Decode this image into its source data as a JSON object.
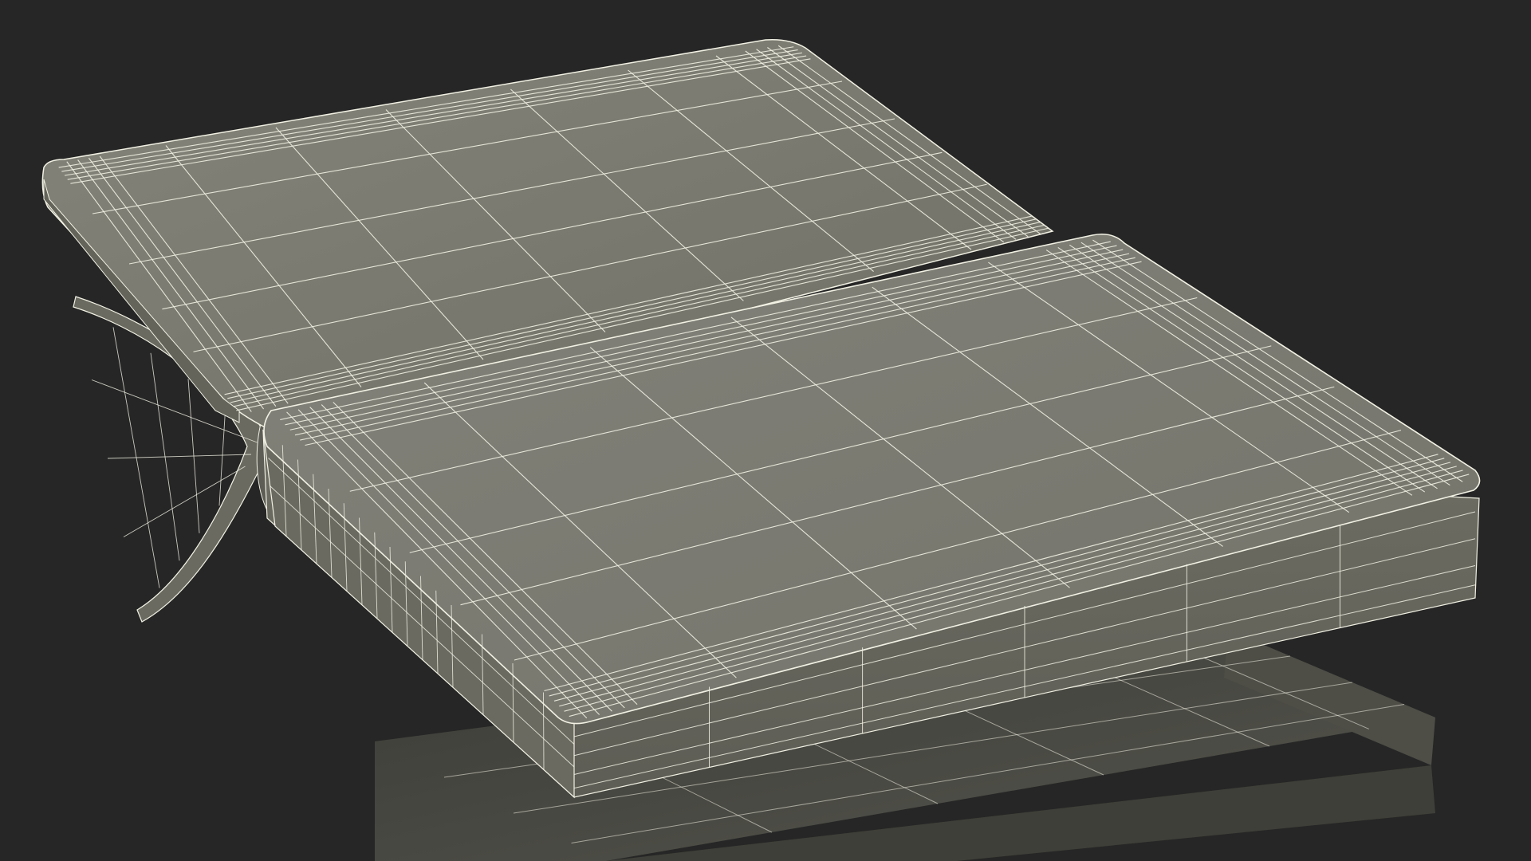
{
  "scene": {
    "background_color": "#262626",
    "surface_color": "#7b7b6f",
    "surface_shadow_color": "#5f5f56",
    "surface_dark_color": "#4a4a43",
    "wire_color": "#f2f1e4",
    "objects": [
      {
        "name": "top-cover-panel",
        "kind": "mesh-panel"
      },
      {
        "name": "front-block",
        "kind": "mesh-block"
      },
      {
        "name": "lower-stack-block",
        "kind": "mesh-block"
      },
      {
        "name": "spine-curl",
        "kind": "mesh-curl"
      }
    ]
  }
}
